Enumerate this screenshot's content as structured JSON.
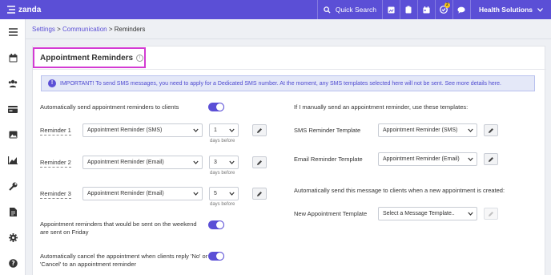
{
  "topbar": {
    "brand": "zanda",
    "search_label": "Quick Search",
    "notification_count": "2",
    "org_name": "Health Solutions"
  },
  "breadcrumb": {
    "settings": "Settings",
    "sep1": " > ",
    "communication": "Communication",
    "sep2": " > ",
    "current": "Reminders"
  },
  "page": {
    "title": "Appointment Reminders",
    "alert": "IMPORTANT! To send SMS messages, you need to apply for a Dedicated SMS number. At the moment, any SMS templates selected here will not be sent. See more details here."
  },
  "left": {
    "auto_send_label": "Automatically send appointment reminders to clients",
    "auto_send_on": true,
    "days_before": "days before",
    "reminders": [
      {
        "label": "Reminder 1",
        "template": "Appointment Reminder (SMS)",
        "days": "1"
      },
      {
        "label": "Reminder 2",
        "template": "Appointment Reminder (Email)",
        "days": "3"
      },
      {
        "label": "Reminder 3",
        "template": "Appointment Reminder (Email)",
        "days": "5"
      }
    ],
    "weekend_label": "Appointment reminders that would be sent on the weekend are sent on Friday",
    "weekend_on": true,
    "cancel_label": "Automatically cancel the appointment when clients reply 'No' or 'Cancel' to an appointment reminder",
    "cancel_on": true
  },
  "right": {
    "manual_heading": "If I manually send an appointment reminder, use these templates:",
    "sms_label": "SMS Reminder Template",
    "sms_value": "Appointment Reminder (SMS)",
    "email_label": "Email Reminder Template",
    "email_value": "Appointment Reminder (Email)",
    "new_heading": "Automatically send this message to clients when a new appointment is created:",
    "new_label": "New Appointment Template",
    "new_value": "Select a Message Template.."
  },
  "colors": {
    "brand": "#5b4fd6",
    "highlight": "#d33bd3",
    "alert_bg": "#e4e8f8"
  }
}
